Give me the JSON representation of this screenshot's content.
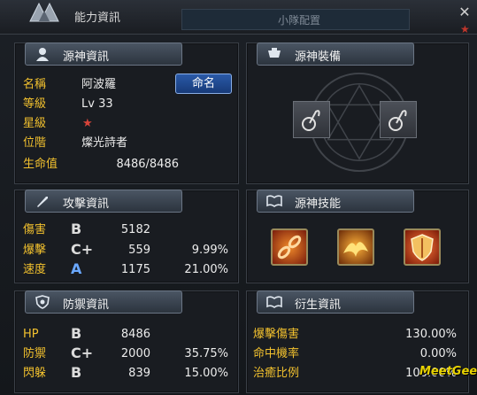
{
  "window": {
    "title": "能力資訊",
    "tab_party": "小隊配置",
    "close": "✕"
  },
  "basic": {
    "title": "源神資訊",
    "name_label": "名稱",
    "name_value": "阿波羅",
    "level_label": "等級",
    "level_value": "Lv 33",
    "star_label": "星級",
    "star_value": "★",
    "rank_label": "位階",
    "rank_value": "燦光詩者",
    "hp_label": "生命值",
    "hp_value": "8486/8486",
    "rename_button": "命名"
  },
  "equipment": {
    "title": "源神裝備"
  },
  "attack": {
    "title": "攻擊資訊",
    "rows": [
      {
        "label": "傷害",
        "grade": "B",
        "value": "5182",
        "percent": ""
      },
      {
        "label": "爆擊",
        "grade": "C+",
        "value": "559",
        "percent": "9.99%"
      },
      {
        "label": "速度",
        "grade": "A",
        "value": "1175",
        "percent": "21.00%"
      }
    ]
  },
  "skills": {
    "title": "源神技能"
  },
  "defense": {
    "title": "防禦資訊",
    "rows": [
      {
        "label": "HP",
        "grade": "B",
        "value": "8486",
        "percent": ""
      },
      {
        "label": "防禦",
        "grade": "C+",
        "value": "2000",
        "percent": "35.75%"
      },
      {
        "label": "閃躲",
        "grade": "B",
        "value": "839",
        "percent": "15.00%"
      }
    ]
  },
  "derived": {
    "title": "衍生資訊",
    "rows": [
      {
        "label": "爆擊傷害",
        "value": "130.00%"
      },
      {
        "label": "命中機率",
        "value": "0.00%"
      },
      {
        "label": "治癒比例",
        "value": "100.00%"
      }
    ]
  },
  "watermark": "MeetGee!",
  "colors": {
    "label": "#f2c12e",
    "grade_a": "#6aa8ff",
    "button": "#2a5aa8"
  }
}
